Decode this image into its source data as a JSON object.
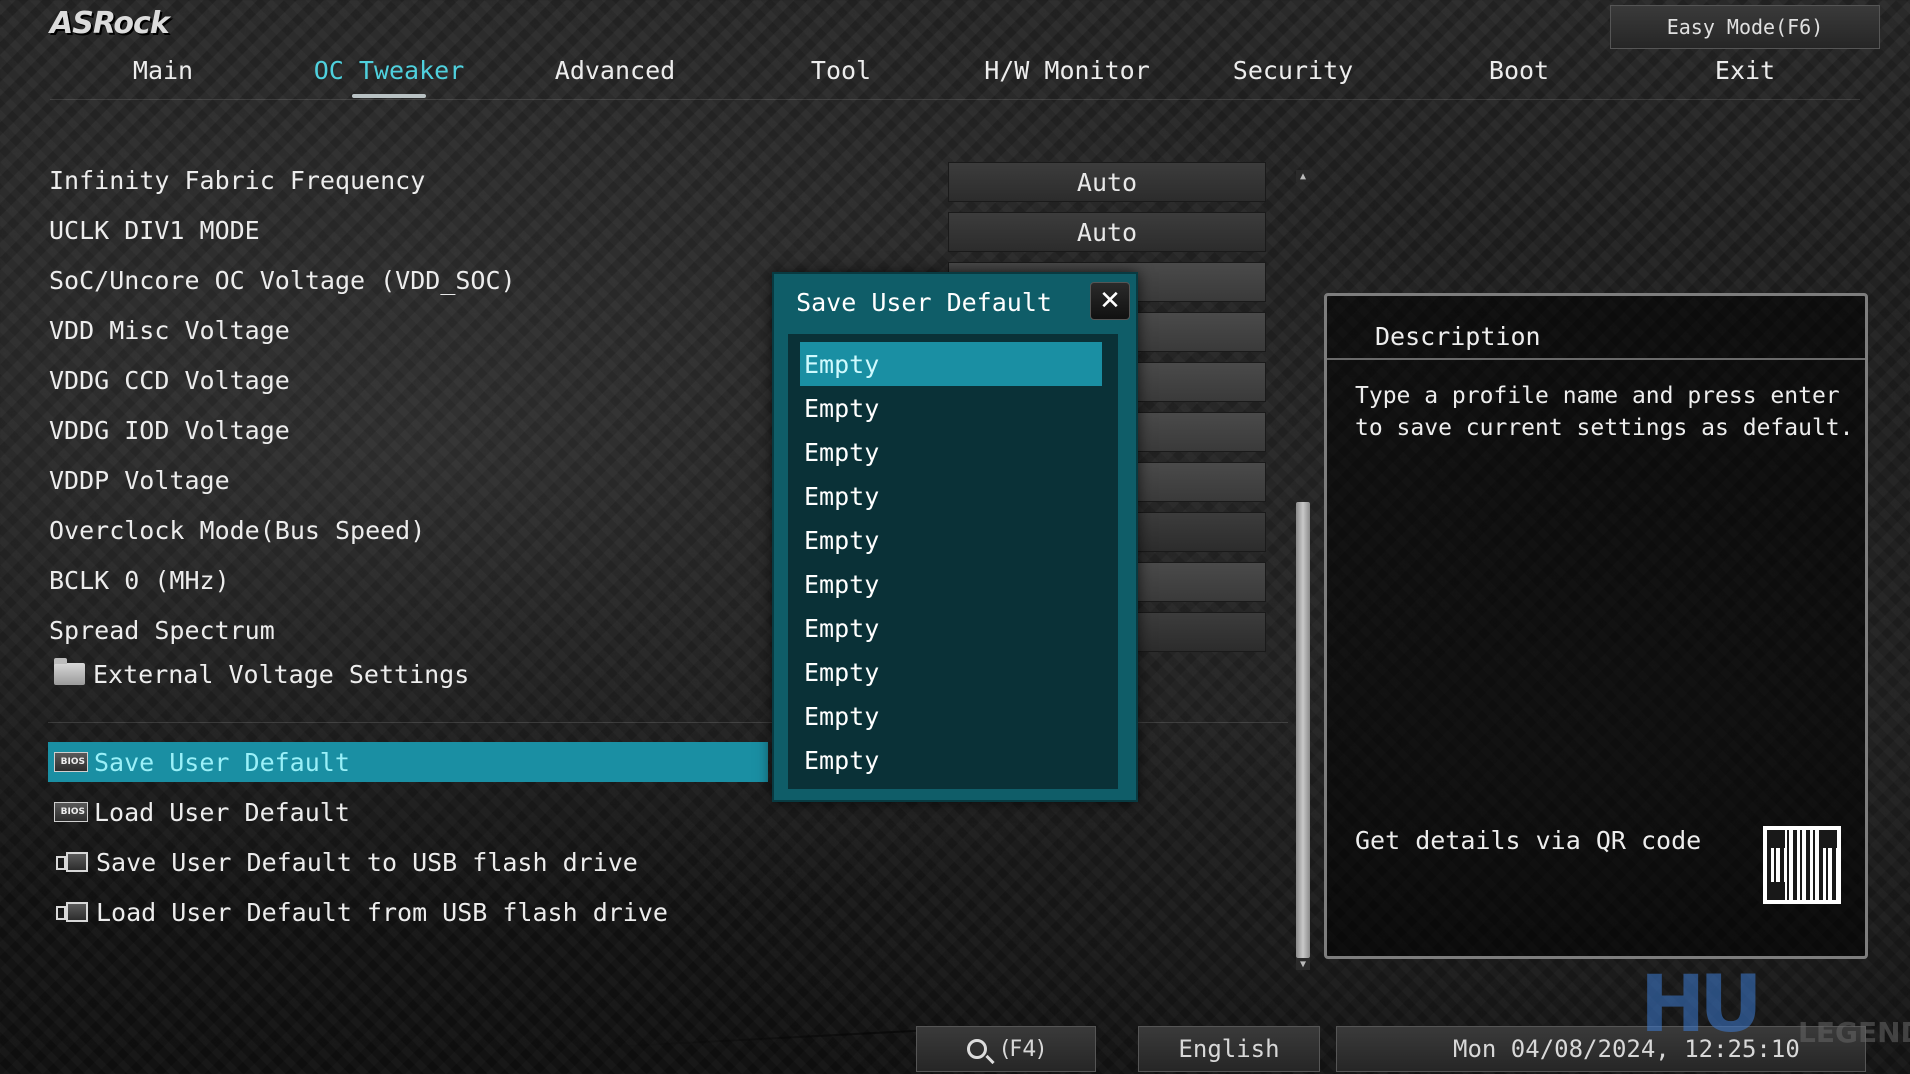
{
  "brand": {
    "logo": "ASRock"
  },
  "easy_mode_label": "Easy Mode(F6)",
  "tabs": [
    {
      "label": "Main"
    },
    {
      "label": "OC Tweaker",
      "active": true
    },
    {
      "label": "Advanced"
    },
    {
      "label": "Tool"
    },
    {
      "label": "H/W Monitor"
    },
    {
      "label": "Security"
    },
    {
      "label": "Boot"
    },
    {
      "label": "Exit"
    }
  ],
  "settings": [
    {
      "label": "Infinity Fabric Frequency",
      "value": "Auto"
    },
    {
      "label": "UCLK DIV1 MODE",
      "value": "Auto"
    },
    {
      "label": "SoC/Uncore OC Voltage (VDD_SOC)",
      "value": ""
    },
    {
      "label": "VDD Misc Voltage",
      "value": ""
    },
    {
      "label": "VDDG CCD Voltage",
      "value": ""
    },
    {
      "label": "VDDG IOD Voltage",
      "value": ""
    },
    {
      "label": "VDDP Voltage",
      "value": ""
    },
    {
      "label": "Overclock Mode(Bus Speed)",
      "value": ""
    },
    {
      "label": "BCLK 0 (MHz)",
      "value": ""
    },
    {
      "label": "Spread Spectrum",
      "value": ""
    }
  ],
  "submenu": {
    "label": "External Voltage Settings"
  },
  "actions": [
    {
      "label": "Save User Default",
      "icon": "bios-chip-icon",
      "selected": true
    },
    {
      "label": "Load User Default",
      "icon": "bios-chip-icon"
    },
    {
      "label": "Save User Default to USB flash drive",
      "icon": "usb-drive-icon"
    },
    {
      "label": "Load User Default from USB flash drive",
      "icon": "usb-drive-icon"
    }
  ],
  "dialog": {
    "title": "Save User Default",
    "close_glyph": "✕",
    "slots": [
      "Empty",
      "Empty",
      "Empty",
      "Empty",
      "Empty",
      "Empty",
      "Empty",
      "Empty",
      "Empty",
      "Empty"
    ],
    "selected_index": 0
  },
  "description": {
    "title": "Description",
    "text": "Type a profile name and press enter to save current settings as default.",
    "qr_label": "Get details via QR code"
  },
  "footer": {
    "search_key": "(F4)",
    "language": "English",
    "datetime": "Mon 04/08/2024, 12:25:10"
  },
  "watermark": {
    "mark": "HU",
    "text": "LEGEND"
  },
  "colors": {
    "accent": "#4fd1de",
    "selection": "#1a8fa3",
    "dialog_bg": "#0f5d68"
  }
}
